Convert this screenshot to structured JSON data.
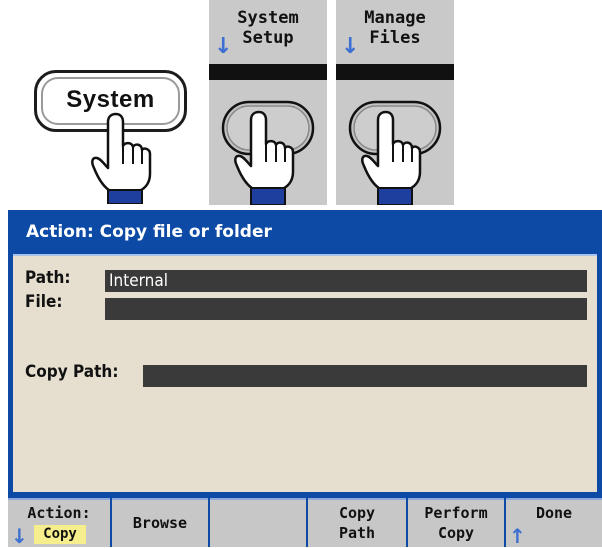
{
  "front_panel": {
    "system_key_label": "System",
    "softkeys": [
      {
        "line1": "System",
        "line2": "Setup",
        "arrow": "↓"
      },
      {
        "line1": "Manage",
        "line2": "Files",
        "arrow": "↓"
      }
    ]
  },
  "screen": {
    "title": "Action: Copy file or folder",
    "fields": {
      "path_label": "Path:",
      "path_value": "Internal",
      "file_label": "File:",
      "file_value": "",
      "copy_path_label": "Copy Path:",
      "copy_path_value": ""
    },
    "softkeys": {
      "action_label": "Action:",
      "action_value": "Copy",
      "action_arrow": "↓",
      "browse": "Browse",
      "copy_path_line1": "Copy",
      "copy_path_line2": "Path",
      "perform_copy_line1": "Perform",
      "perform_copy_line2": "Copy",
      "done": "Done",
      "done_arrow": "↑"
    }
  },
  "colors": {
    "title_bar": "#0c4aa6",
    "content_bg": "#e6dfcf",
    "field_bg": "#3a3a3a",
    "softkey_bg": "#c7c7c7",
    "arrow": "#3b6fd1",
    "highlight": "#f6ee8c"
  },
  "icons": [
    "pointing-hand-icon",
    "down-arrow-icon",
    "up-arrow-icon"
  ]
}
